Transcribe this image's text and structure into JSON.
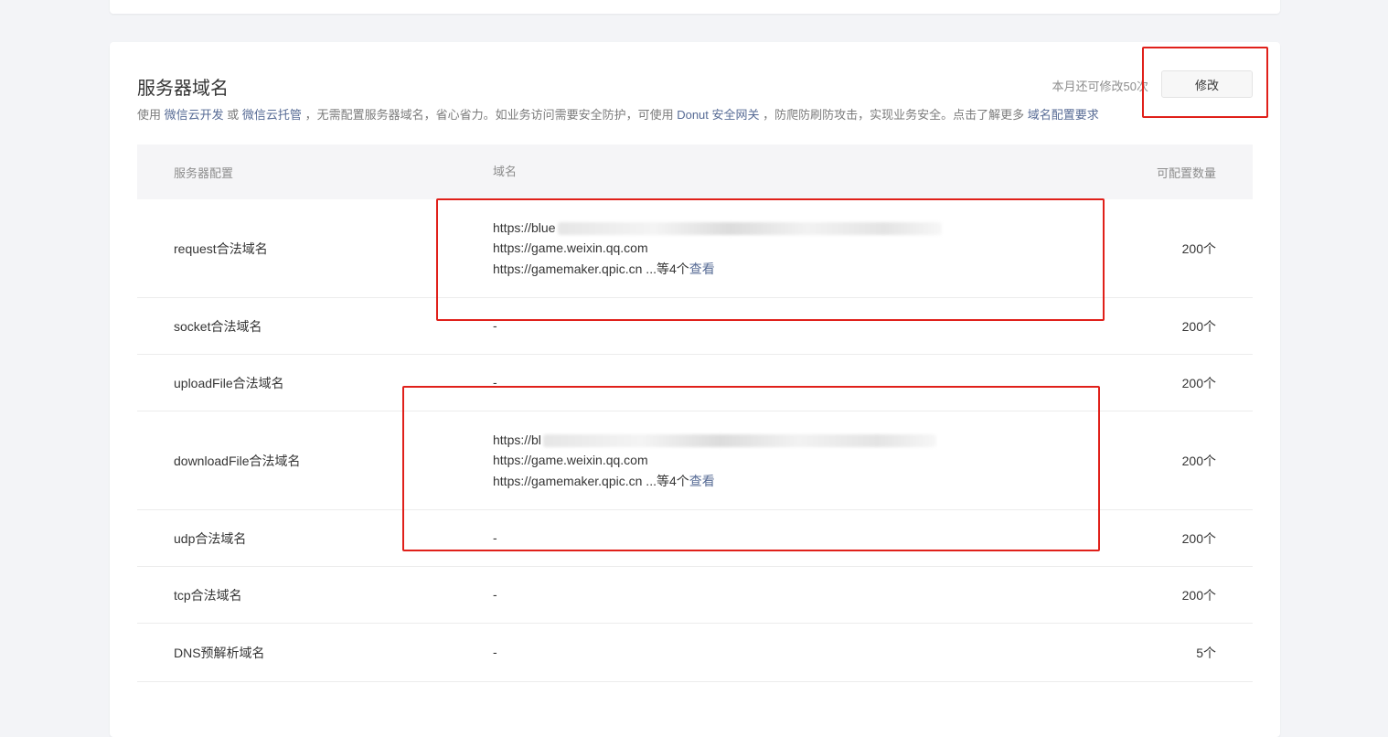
{
  "section": {
    "title": "服务器域名",
    "remaining": "本月还可修改50次",
    "edit_button": "修改",
    "desc": {
      "prefix": "使用",
      "link_cloudbase": "微信云开发",
      "or": "或",
      "link_hosting": "微信云托管",
      "middle": "，无需配置服务器域名，省心省力。如业务访问需要安全防护，可使用",
      "link_donut": "Donut 安全网关",
      "after": "，防爬防刷防攻击，实现业务安全。点击了解更多",
      "link_requirements": "域名配置要求"
    }
  },
  "table": {
    "headers": {
      "config": "服务器配置",
      "domain": "域名",
      "count": "可配置数量"
    },
    "rows": [
      {
        "name": "request合法域名",
        "domains": [
          "https://blue",
          "https://game.weixin.qq.com",
          "https://gamemaker.qpic.cn"
        ],
        "more": " ...等4个",
        "view": "查看",
        "count": "200个"
      },
      {
        "name": "socket合法域名",
        "value": "-",
        "count": "200个"
      },
      {
        "name": "uploadFile合法域名",
        "value": "-",
        "count": "200个"
      },
      {
        "name": "downloadFile合法域名",
        "domains": [
          "https://bl",
          "https://game.weixin.qq.com",
          "https://gamemaker.qpic.cn"
        ],
        "more": " ...等4个",
        "view": "查看",
        "count": "200个"
      },
      {
        "name": "udp合法域名",
        "value": "-",
        "count": "200个"
      },
      {
        "name": "tcp合法域名",
        "value": "-",
        "count": "200个"
      },
      {
        "name": "DNS预解析域名",
        "value": "-",
        "count": "5个"
      }
    ]
  },
  "annotations": {
    "box_color": "#e0201a"
  }
}
